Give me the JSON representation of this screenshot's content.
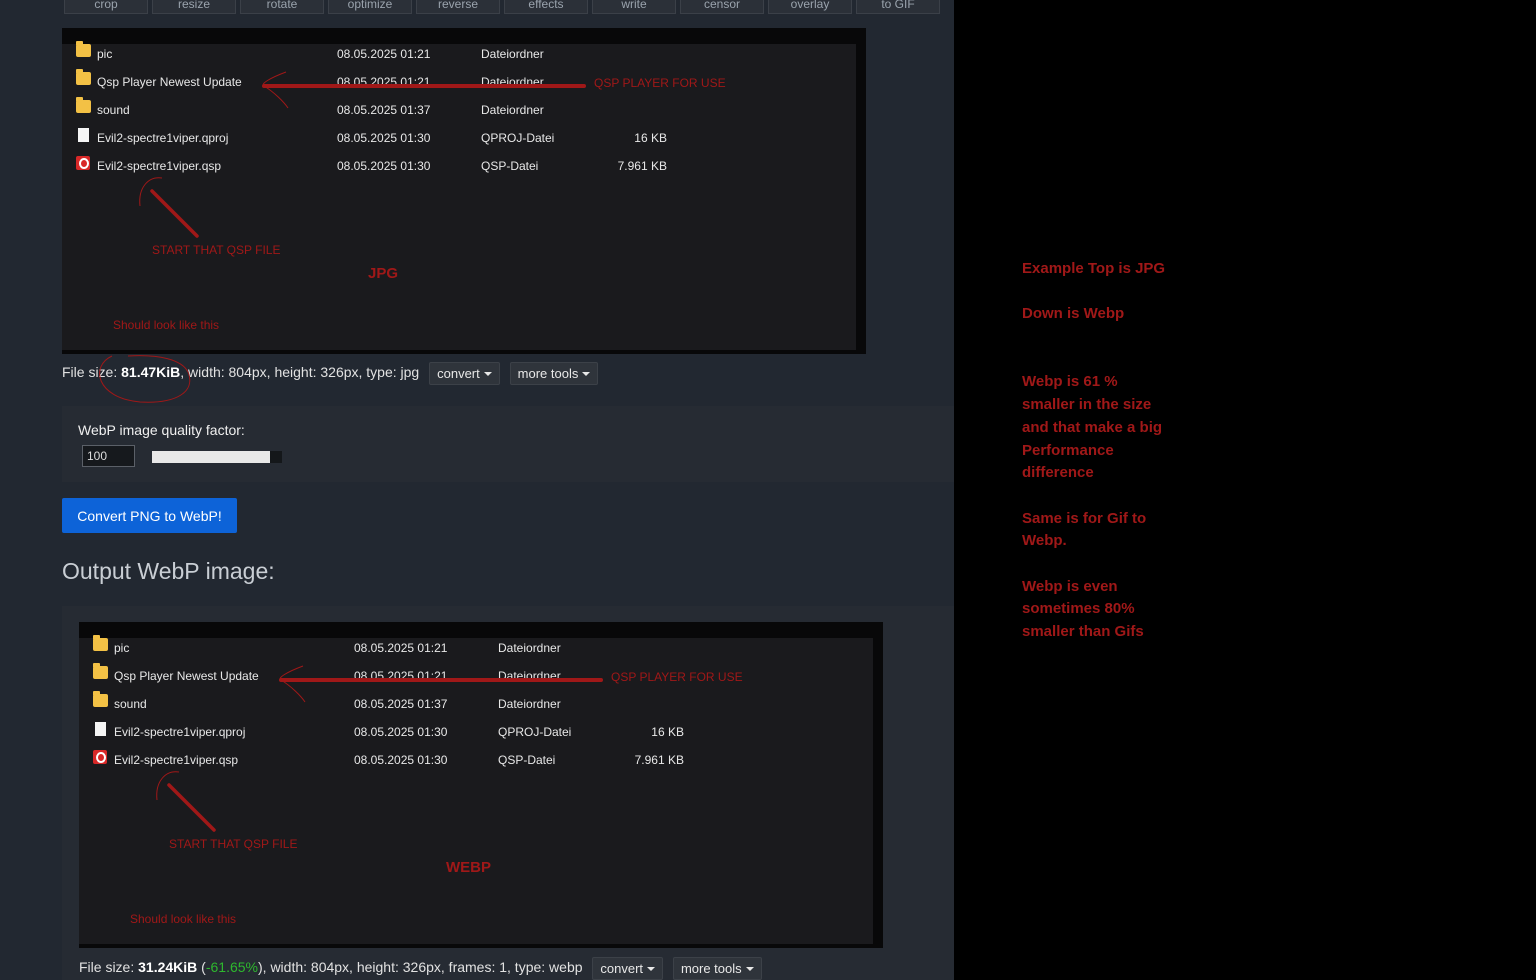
{
  "toolbar": {
    "tabs": [
      "crop",
      "resize",
      "rotate",
      "optimize",
      "reverse",
      "effects",
      "write",
      "censor",
      "overlay",
      "to GIF"
    ]
  },
  "image_rows": [
    {
      "icon": "folder-icon",
      "name": "pic",
      "date": "08.05.2025 01:21",
      "type": "Dateiordner",
      "size": ""
    },
    {
      "icon": "folder-icon",
      "name": "Qsp Player Newest Update",
      "date": "08.05.2025 01:21",
      "type": "Dateiordner",
      "size": ""
    },
    {
      "icon": "folder-icon",
      "name": "sound",
      "date": "08.05.2025 01:37",
      "type": "Dateiordner",
      "size": ""
    },
    {
      "icon": "file-icon",
      "name": "Evil2-spectre1viper.qproj",
      "date": "08.05.2025 01:30",
      "type": "QPROJ-Datei",
      "size": "16 KB"
    },
    {
      "icon": "qsp-file-icon",
      "name": "Evil2-spectre1viper.qsp",
      "date": "08.05.2025 01:30",
      "type": "QSP-Datei",
      "size": "7.961 KB"
    }
  ],
  "annotations": {
    "player": "QSP PLAYER FOR USE",
    "start": "START THAT QSP FILE",
    "should": "Should look like this",
    "jpg_label": "JPG",
    "webp_label": "WEBP"
  },
  "input_info": {
    "prefix": "File size: ",
    "size": "81.47KiB",
    "details": ", width: 804px, height: 326px, type: jpg",
    "convert": "convert",
    "more_tools": "more tools"
  },
  "quality": {
    "label": "WebP image quality factor:",
    "value": "100",
    "slider_level": 0.91
  },
  "convert_button": "Convert PNG to WebP!",
  "output_title": "Output WebP image:",
  "output_info": {
    "prefix": "File size: ",
    "size": "31.24KiB",
    "paren_open": " (",
    "delta": "-61.65%",
    "details": "), width: 804px, height: 326px, frames: 1, type: webp",
    "convert": "convert",
    "more_tools": "more tools"
  },
  "notes": [
    "Example Top is JPG",
    "Down is Webp",
    "Webp is 61 % smaller in the size and that make a big Performance difference",
    "Same is for Gif to Webp.",
    "Webp is even sometimes 80% smaller than Gifs"
  ],
  "colors": {
    "panel_bg": "#222831",
    "annotation_red": "#a01818",
    "primary_button": "#0d63d8",
    "delta_green": "#2eb82e"
  }
}
